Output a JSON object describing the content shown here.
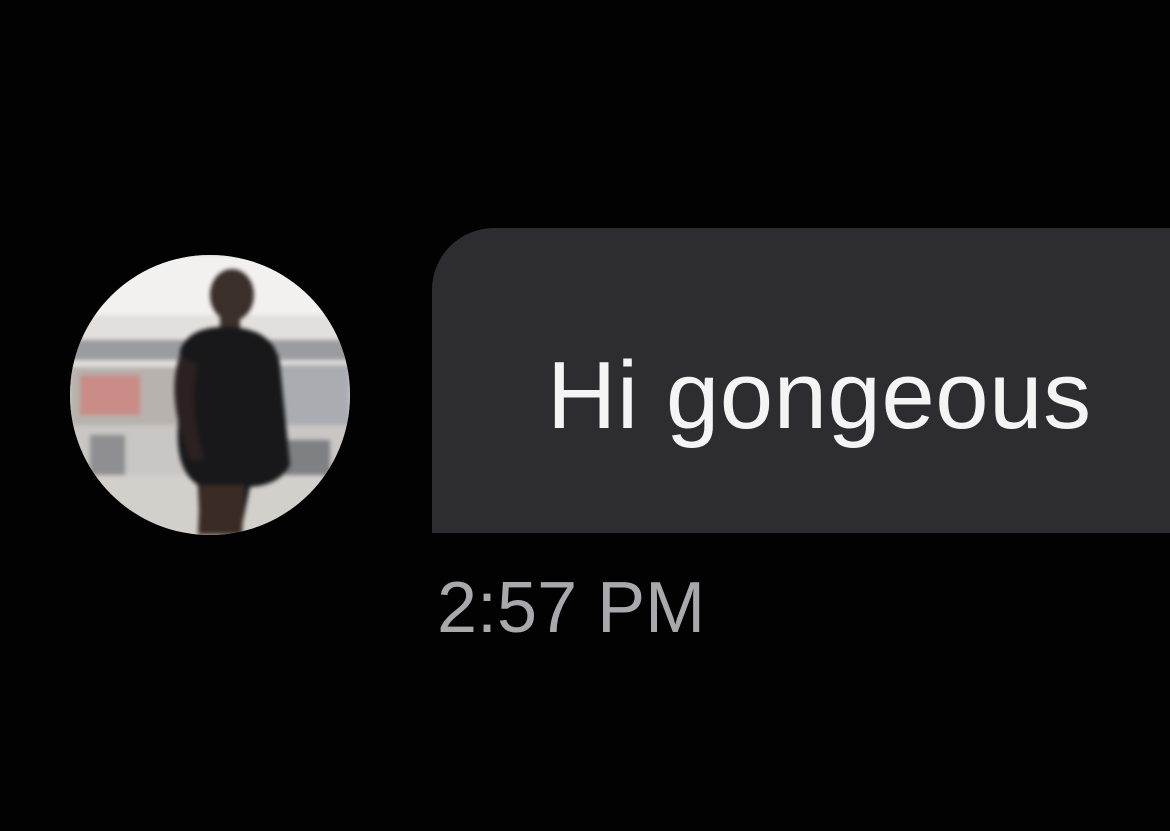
{
  "conversation": {
    "sender": {
      "avatar_icon": "profile-photo"
    },
    "message": {
      "text": "Hi gongeous",
      "timestamp": "2:57 PM"
    }
  },
  "colors": {
    "background": "#020203",
    "bubble": "#2d2c31",
    "message_text": "#f4f4f4",
    "timestamp_text": "#a9a9ad"
  }
}
